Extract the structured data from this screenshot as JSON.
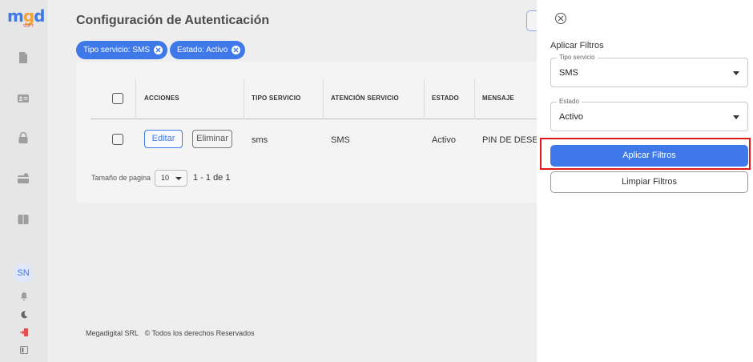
{
  "sidebar": {
    "logo": {
      "m": "m",
      "g": "g",
      "d": "d",
      "sub": "SOFT"
    },
    "avatar_initials": "SN",
    "icons": [
      "document-icon",
      "id-card-icon",
      "lock-icon",
      "card-icon",
      "book-icon",
      "bell-icon",
      "moon-icon",
      "logout-icon",
      "collapse-icon"
    ]
  },
  "page": {
    "title": "Configuración de Autenticación"
  },
  "filters": {
    "chips": [
      "Tipo servicio: SMS",
      "Estado: Activo"
    ]
  },
  "table": {
    "headers": [
      "ACCIONES",
      "TIPO SERVICIO",
      "ATENCIÓN SERVICIO",
      "ESTADO",
      "MENSAJE"
    ],
    "rows": [
      {
        "edit_label": "Editar",
        "delete_label": "Eliminar",
        "tipo_servicio": "sms",
        "atencion_servicio": "SMS",
        "estado": "Activo",
        "mensaje": "PIN DE DESE"
      }
    ]
  },
  "pagination": {
    "label": "Tamaño de pagina",
    "page_size": "10",
    "range": "1 - 1 de 1"
  },
  "footer": {
    "company": "Megadigital SRL",
    "rights": "© Todos los derechos Reservados"
  },
  "panel": {
    "title": "Aplicar Filtros",
    "tipo_servicio": {
      "label": "Tipo servicio",
      "value": "SMS"
    },
    "estado": {
      "label": "Estado",
      "value": "Activo"
    },
    "apply_label": "Aplicar Filtros",
    "clear_label": "Limpiar Filtros"
  },
  "colors": {
    "accent": "#3f78e8",
    "highlight": "#e01919"
  }
}
